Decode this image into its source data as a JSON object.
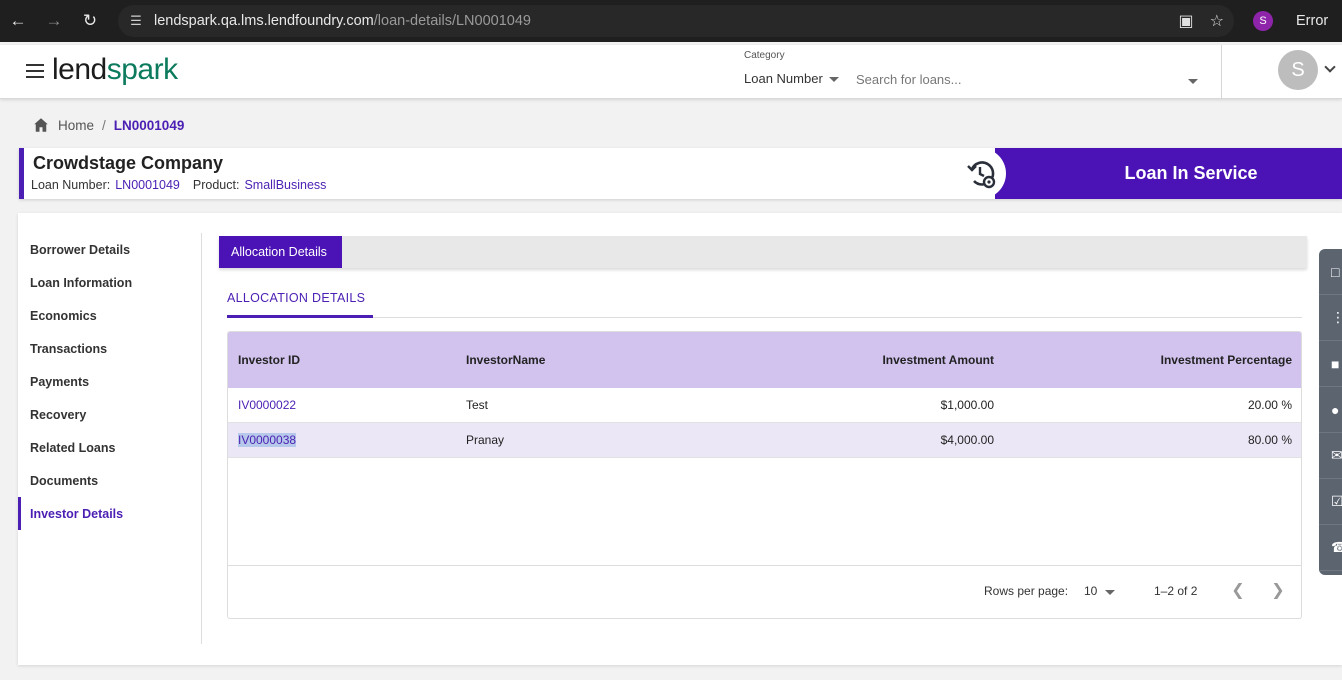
{
  "browser": {
    "url_host": "lendspark.qa.lms.lendfoundry.com",
    "url_path": "/loan-details/LN0001049",
    "profile_initial": "S",
    "status_chip": "Error"
  },
  "header": {
    "logo_part1": "lend",
    "logo_part2": "spark",
    "category_label": "Category",
    "category_value": "Loan Number",
    "search_placeholder": "Search for loans...",
    "avatar_initial": "S"
  },
  "breadcrumb": {
    "home": "Home",
    "separator": "/",
    "current": "LN0001049"
  },
  "loan": {
    "company": "Crowdstage Company",
    "loan_number_label": "Loan Number:",
    "loan_number": "LN0001049",
    "product_label": "Product:",
    "product": "SmallBusiness",
    "status": "Loan In Service"
  },
  "side_nav": {
    "items": [
      {
        "label": "Borrower Details"
      },
      {
        "label": "Loan Information"
      },
      {
        "label": "Economics"
      },
      {
        "label": "Transactions"
      },
      {
        "label": "Payments"
      },
      {
        "label": "Recovery"
      },
      {
        "label": "Related Loans"
      },
      {
        "label": "Documents"
      },
      {
        "label": "Investor Details"
      }
    ],
    "active": "Investor Details"
  },
  "tabs": {
    "active_tab": "Allocation Details",
    "section_title": "ALLOCATION DETAILS"
  },
  "table": {
    "columns": [
      "Investor ID",
      "InvestorName",
      "Investment Amount",
      "Investment Percentage"
    ],
    "rows": [
      {
        "id": "IV0000022",
        "name": "Test",
        "amount": "$1,000.00",
        "percentage": "20.00 %"
      },
      {
        "id": "IV0000038",
        "name": "Pranay",
        "amount": "$4,000.00",
        "percentage": "80.00 %"
      }
    ],
    "rows_per_page_label": "Rows per page:",
    "rows_per_page": "10",
    "range": "1–2 of 2"
  },
  "colors": {
    "accent": "#4b12b5",
    "header_row": "#d2c3ee",
    "logo_green": "#0b7a5d"
  }
}
